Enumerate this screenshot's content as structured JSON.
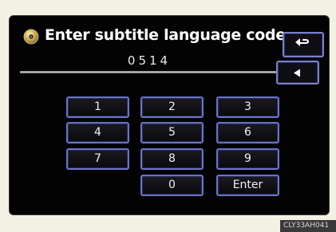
{
  "header": {
    "title": "Enter subtitle language code",
    "code_value": "0514",
    "icon": "disc-icon"
  },
  "buttons": {
    "return_icon": "return-arrow-icon",
    "back_icon": "backspace-arrow-icon"
  },
  "keypad": {
    "keys": [
      "1",
      "2",
      "3",
      "4",
      "5",
      "6",
      "7",
      "8",
      "9",
      "0",
      "Enter"
    ]
  },
  "colors": {
    "screen_bg": "#030303",
    "key_border": "#6b72c4",
    "frame_bg": "#f3f1e3"
  },
  "watermark": "CLY33AH041"
}
